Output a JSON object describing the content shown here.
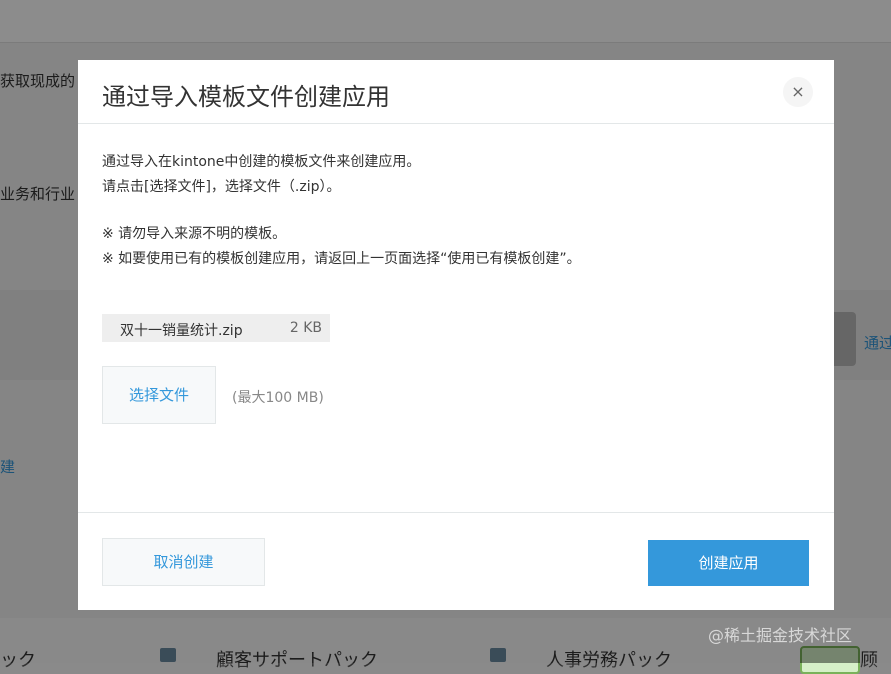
{
  "background": {
    "text_top": "获取现成的",
    "text_middle": "业务和行业",
    "link_left": "建",
    "link_right": "通过",
    "packs": [
      "ック",
      "顧客サポートパック",
      "人事労務パック",
      "顾"
    ]
  },
  "dialog": {
    "title": "通过导入模板文件创建应用",
    "close_symbol": "×",
    "desc_line1": "通过导入在kintone中创建的模板文件来创建应用。",
    "desc_line2": "请点击[选择文件]，选择文件（.zip）。",
    "note_line1": "※ 请勿导入来源不明的模板。",
    "note_line2": "※ 如要使用已有的模板创建应用，请返回上一页面选择“使用已有模板创建”。",
    "file": {
      "name": "双十一销量统计.zip",
      "size": "2 KB"
    },
    "choose_button": "选择文件",
    "max_size": "(最大100 MB)",
    "cancel_button": "取消创建",
    "create_button": "创建应用"
  },
  "watermark": "@稀土掘金技术社区",
  "colors": {
    "accent": "#3498db",
    "overlay": "rgba(0,0,0,0.45)"
  }
}
